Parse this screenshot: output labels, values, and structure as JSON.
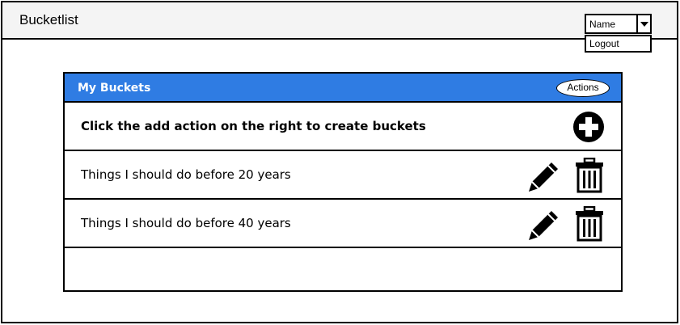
{
  "app": {
    "title": "Bucketlist"
  },
  "user_menu": {
    "selected": "Name",
    "items": [
      "Logout"
    ]
  },
  "panel": {
    "title": "My Buckets",
    "actions_label": "Actions",
    "hint": "Click the add action on the right to create buckets",
    "buckets": [
      {
        "label": "Things I should do before 20 years"
      },
      {
        "label": "Things I should do before 40 years"
      }
    ]
  },
  "colors": {
    "header_bg": "#2f7ce3",
    "topbar_bg": "#f4f4f4"
  },
  "icons": [
    "add-icon",
    "edit-icon",
    "trash-icon",
    "chevron-down-icon"
  ]
}
